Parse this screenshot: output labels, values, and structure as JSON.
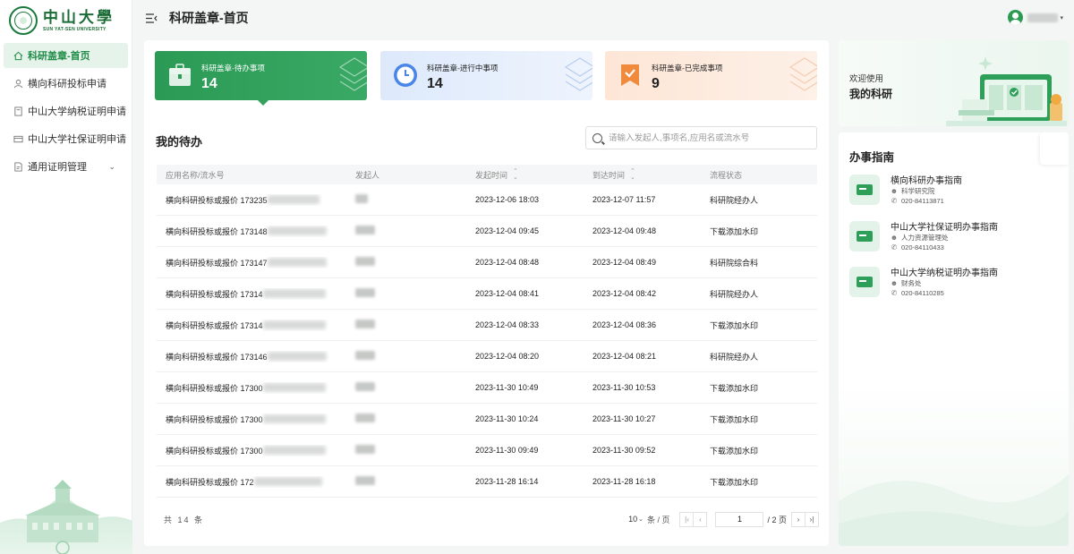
{
  "brand": {
    "name_cn": "中山大學",
    "name_en": "SUN YAT-SEN UNIVERSITY"
  },
  "header": {
    "title": "科研盖章-首页"
  },
  "sidebar": {
    "items": [
      {
        "label": "科研盖章-首页",
        "icon": "home-icon",
        "active": true
      },
      {
        "label": "横向科研投标申请",
        "icon": "user-icon"
      },
      {
        "label": "中山大学纳税证明申请",
        "icon": "document-icon"
      },
      {
        "label": "中山大学社保证明申请",
        "icon": "card-icon"
      },
      {
        "label": "通用证明管理",
        "icon": "file-icon",
        "expandable": true
      }
    ]
  },
  "stats": [
    {
      "label": "科研盖章-待办事项",
      "value": "14",
      "icon": "briefcase-icon",
      "color": "#2a9a55"
    },
    {
      "label": "科研盖章-进行中事项",
      "value": "14",
      "icon": "clock-icon",
      "color": "#4a86e8"
    },
    {
      "label": "科研盖章-已完成事项",
      "value": "9",
      "icon": "check-badge-icon",
      "color": "#f08a3c"
    }
  ],
  "todo": {
    "title": "我的待办",
    "search_placeholder": "请输入发起人,事项名,应用名或流水号",
    "columns": [
      "应用名称/流水号",
      "发起人",
      "发起时间",
      "到达时间",
      "流程状态"
    ],
    "rows": [
      {
        "app": "横向科研投标或报价 173235",
        "start": "2023-12-06 18:03",
        "arrive": "2023-12-07 11:57",
        "status": "科研院经办人"
      },
      {
        "app": "横向科研投标或报价 173148",
        "start": "2023-12-04 09:45",
        "arrive": "2023-12-04 09:48",
        "status": "下载添加水印"
      },
      {
        "app": "横向科研投标或报价 173147",
        "start": "2023-12-04 08:48",
        "arrive": "2023-12-04 08:49",
        "status": "科研院综合科"
      },
      {
        "app": "横向科研投标或报价 17314",
        "start": "2023-12-04 08:41",
        "arrive": "2023-12-04 08:42",
        "status": "科研院经办人"
      },
      {
        "app": "横向科研投标或报价 17314",
        "start": "2023-12-04 08:33",
        "arrive": "2023-12-04 08:36",
        "status": "下载添加水印"
      },
      {
        "app": "横向科研投标或报价 173146",
        "start": "2023-12-04 08:20",
        "arrive": "2023-12-04 08:21",
        "status": "科研院经办人"
      },
      {
        "app": "横向科研投标或报价 17300",
        "start": "2023-11-30 10:49",
        "arrive": "2023-11-30 10:53",
        "status": "下载添加水印"
      },
      {
        "app": "横向科研投标或报价 17300",
        "start": "2023-11-30 10:24",
        "arrive": "2023-11-30 10:27",
        "status": "下载添加水印"
      },
      {
        "app": "横向科研投标或报价 17300",
        "start": "2023-11-30 09:49",
        "arrive": "2023-11-30 09:52",
        "status": "下载添加水印"
      },
      {
        "app": "横向科研投标或报价 172",
        "start": "2023-11-28 16:14",
        "arrive": "2023-11-28 16:18",
        "status": "下载添加水印"
      }
    ],
    "total_text": "共 14 条",
    "page_size": "10",
    "page_size_unit": "条 / 页",
    "current_page": "1",
    "total_pages": "/ 2 页"
  },
  "welcome": {
    "line1": "欢迎使用",
    "line2": "我的科研"
  },
  "guide": {
    "title": "办事指南",
    "items": [
      {
        "name": "横向科研办事指南",
        "dept": "科学研究院",
        "phone": "020-84113871"
      },
      {
        "name": "中山大学社保证明办事指南",
        "dept": "人力资源管理处",
        "phone": "020-84110433"
      },
      {
        "name": "中山大学纳税证明办事指南",
        "dept": "财务处",
        "phone": "020-84110285"
      }
    ]
  }
}
